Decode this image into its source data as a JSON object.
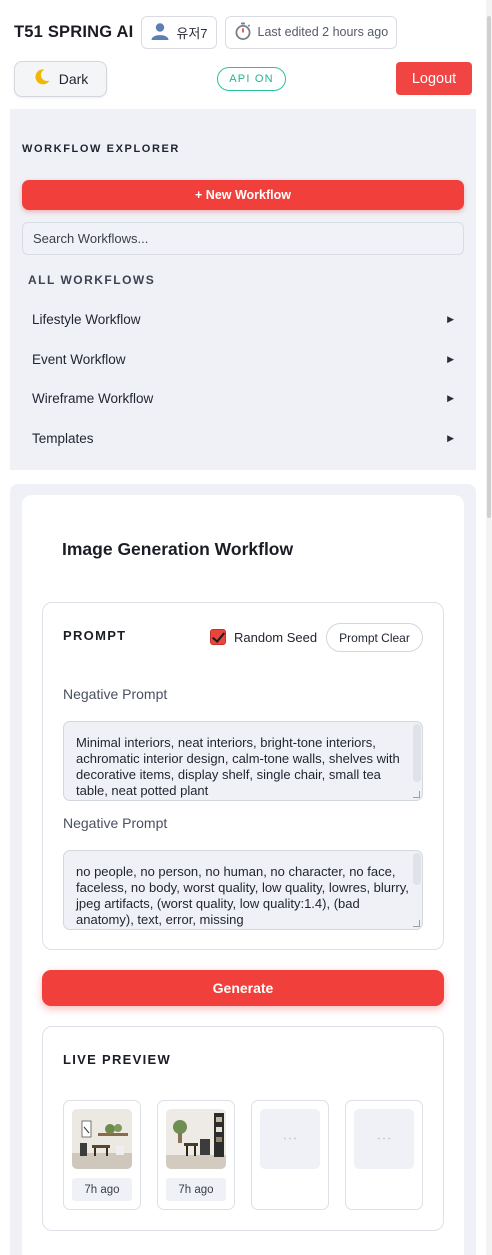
{
  "header": {
    "app_title": "T51 SPRING AI",
    "user_name": "유저7",
    "last_edited": "Last edited 2 hours ago",
    "theme_label": "Dark",
    "api_status": "API ON",
    "logout_label": "Logout"
  },
  "sidebar": {
    "title": "WORKFLOW EXPLORER",
    "new_button": "+ New Workflow",
    "search_placeholder": "Search Workflows...",
    "section_label": "ALL WORKFLOWS",
    "items": [
      {
        "label": "Lifestyle Workflow"
      },
      {
        "label": "Event Workflow"
      },
      {
        "label": "Wireframe Workflow"
      },
      {
        "label": "Templates"
      }
    ]
  },
  "main": {
    "title": "Image Generation Workflow",
    "prompt": {
      "section_label": "PROMPT",
      "random_seed_label": "Random Seed",
      "random_seed_checked": true,
      "clear_label": "Prompt Clear",
      "fields": [
        {
          "label": "Negative Prompt",
          "value": "Minimal interiors, neat interiors, bright-tone interiors, achromatic interior design, calm-tone walls, shelves with decorative items, display shelf, single chair, small tea table, neat potted plant"
        },
        {
          "label": "Negative Prompt",
          "value": "no people, no person, no human, no character, no face, faceless, no body, worst quality, low quality, lowres, blurry, jpeg artifacts, (worst quality, low quality:1.4), (bad anatomy), text, error, missing"
        }
      ]
    },
    "generate_label": "Generate",
    "preview": {
      "section_label": "LIVE PREVIEW",
      "items": [
        {
          "time": "7h ago"
        },
        {
          "time": "7h ago"
        }
      ]
    }
  },
  "colors": {
    "accent": "#f13f3b",
    "api_green": "#22b58c",
    "panel_bg": "#eff1f6"
  }
}
